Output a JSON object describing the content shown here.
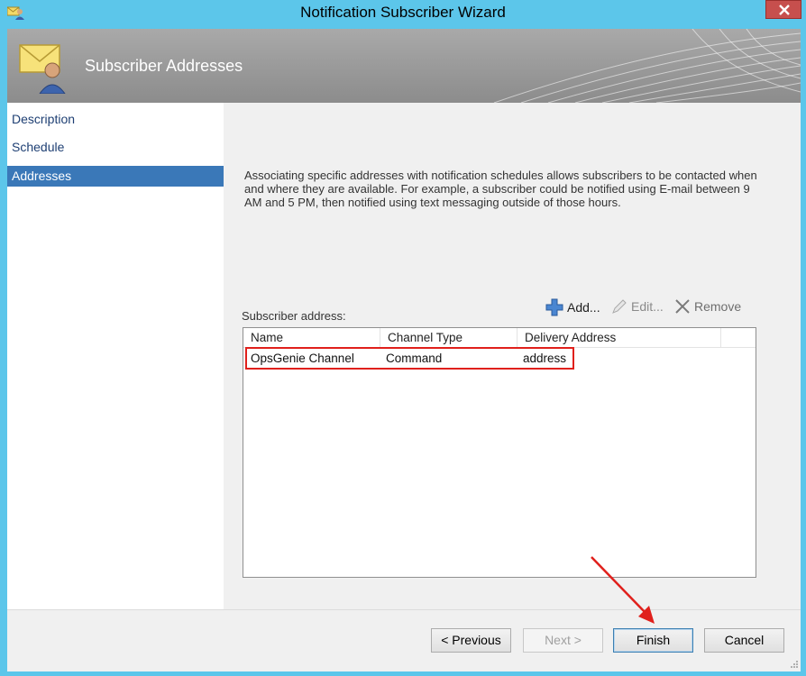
{
  "window": {
    "title": "Notification Subscriber Wizard"
  },
  "banner": {
    "title": "Subscriber Addresses"
  },
  "nav": {
    "items": [
      {
        "label": "Description"
      },
      {
        "label": "Schedule"
      },
      {
        "label": "Addresses",
        "selected": true
      }
    ]
  },
  "main": {
    "description": "Associating specific addresses with notification schedules allows subscribers to be contacted when and where they are available. For example, a subscriber could be notified using E-mail between 9 AM and 5 PM, then notified using text messaging outside of those hours.",
    "subscriber_label": "Subscriber address:",
    "toolbar": {
      "add": "Add...",
      "edit": "Edit...",
      "remove": "Remove"
    },
    "table": {
      "columns": [
        "Name",
        "Channel Type",
        "Delivery Address"
      ],
      "rows": [
        [
          "OpsGenie Channel",
          "Command",
          "address"
        ]
      ]
    }
  },
  "footer": {
    "previous": "< Previous",
    "next": "Next >",
    "finish": "Finish",
    "cancel": "Cancel"
  },
  "colors": {
    "selection": "#3a78b8",
    "highlight": "#e0201c",
    "frame": "#5cc6ea",
    "close": "#c74f4d"
  },
  "icons": {
    "window": "user-envelope-icon",
    "banner": "envelope-user-icon",
    "add": "plus-icon",
    "edit": "pencil-icon",
    "remove": "x-icon",
    "close": "close-icon"
  }
}
